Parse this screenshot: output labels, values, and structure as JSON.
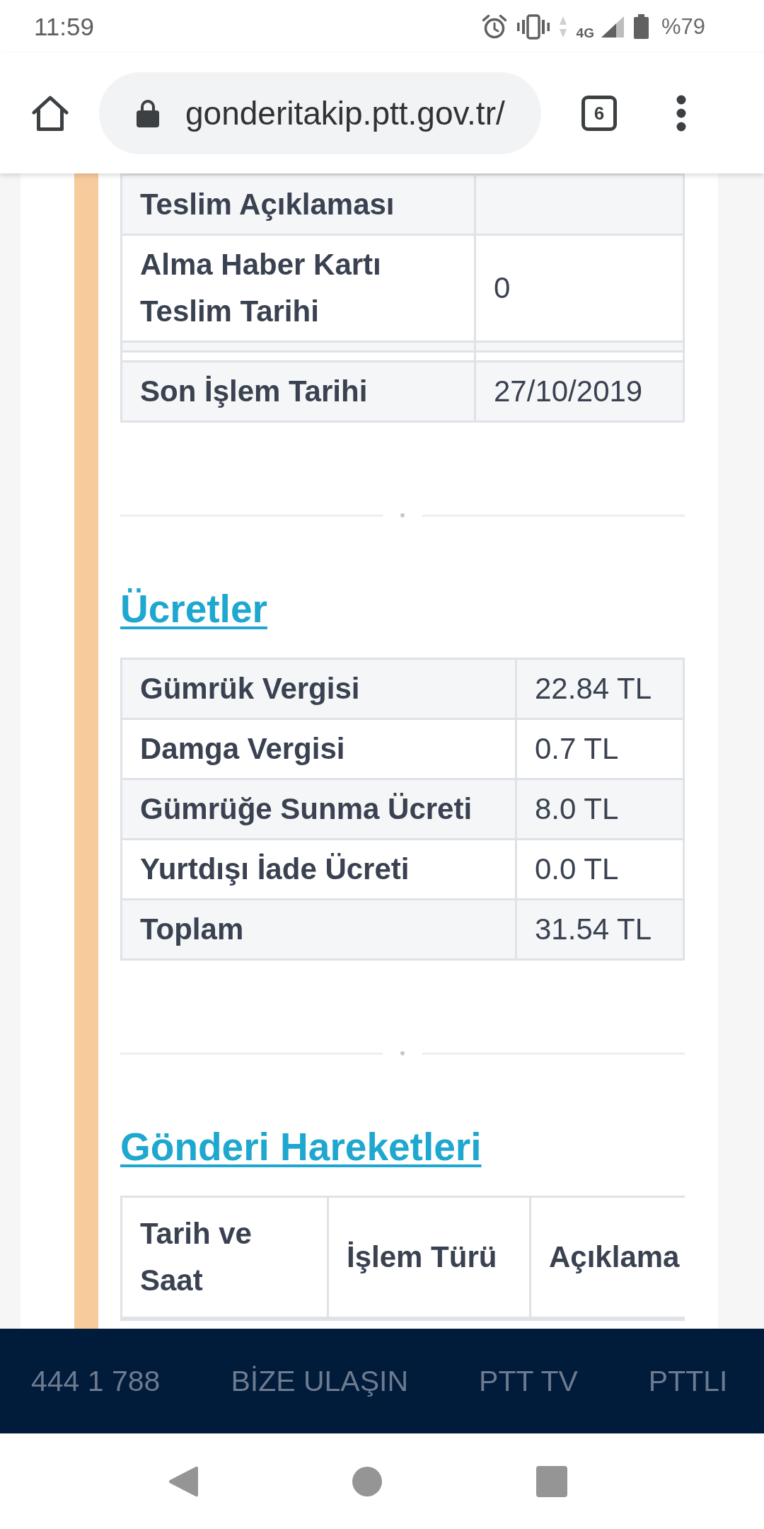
{
  "status_bar": {
    "time": "11:59",
    "network": "4G",
    "battery": "%79"
  },
  "browser": {
    "url": "gonderitakip.ptt.gov.tr/",
    "tab_count": "6"
  },
  "details_table": {
    "rows": [
      {
        "kind": "data",
        "label": "Teslim Açıklaması"
      },
      {
        "kind": "data",
        "label": "Alma Haber Kartı Teslim Tarihi",
        "value": "0"
      },
      {
        "kind": "blank"
      },
      {
        "kind": "blank"
      },
      {
        "kind": "data",
        "label": "Son İşlem Tarihi",
        "value": "27/10/2019"
      }
    ]
  },
  "fees": {
    "title": "Ücretler",
    "rows": [
      {
        "label": "Gümrük Vergisi",
        "value": "22.84 TL"
      },
      {
        "label": "Damga Vergisi",
        "value": "0.7 TL"
      },
      {
        "label": "Gümrüğe Sunma Ücreti",
        "value": "8.0 TL"
      },
      {
        "label": "Yurtdışı İade Ücreti",
        "value": "0.0 TL"
      },
      {
        "label": "Toplam",
        "value": "31.54 TL"
      }
    ]
  },
  "movements": {
    "title": "Gönderi Hareketleri",
    "columns": [
      "Tarih ve Saat",
      "İşlem Türü",
      "Açıklama"
    ]
  },
  "footer": {
    "links": [
      "444 1 788",
      "BİZE ULAŞIN",
      "PTT TV",
      "PTTLI"
    ]
  }
}
